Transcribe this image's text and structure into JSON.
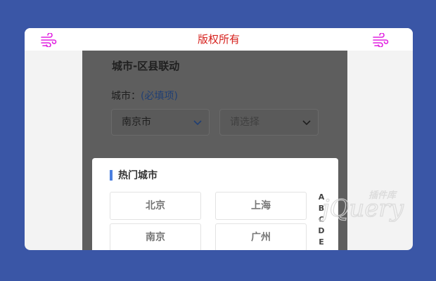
{
  "topbar": {
    "title": "版权所有"
  },
  "form": {
    "heading": "城市-区县联动",
    "city_label": "城市：",
    "required": "(必填项)",
    "city_select": "南京市",
    "district_select": "请选择"
  },
  "picker": {
    "section_title": "热门城市",
    "cities": [
      "北京",
      "上海",
      "南京",
      "广州"
    ],
    "alphabet": [
      "A",
      "B",
      "C",
      "D",
      "E"
    ]
  },
  "watermark": {
    "main": "jQuery",
    "sub": "插件库"
  },
  "colors": {
    "background": "#3a56a6",
    "title_red": "#d6201c",
    "icon_magenta": "#e020e0",
    "accent_blue": "#4a7fe0"
  },
  "icons": {
    "left": "wind-icon",
    "right": "wind-icon",
    "select": "chevron-down-icon"
  }
}
